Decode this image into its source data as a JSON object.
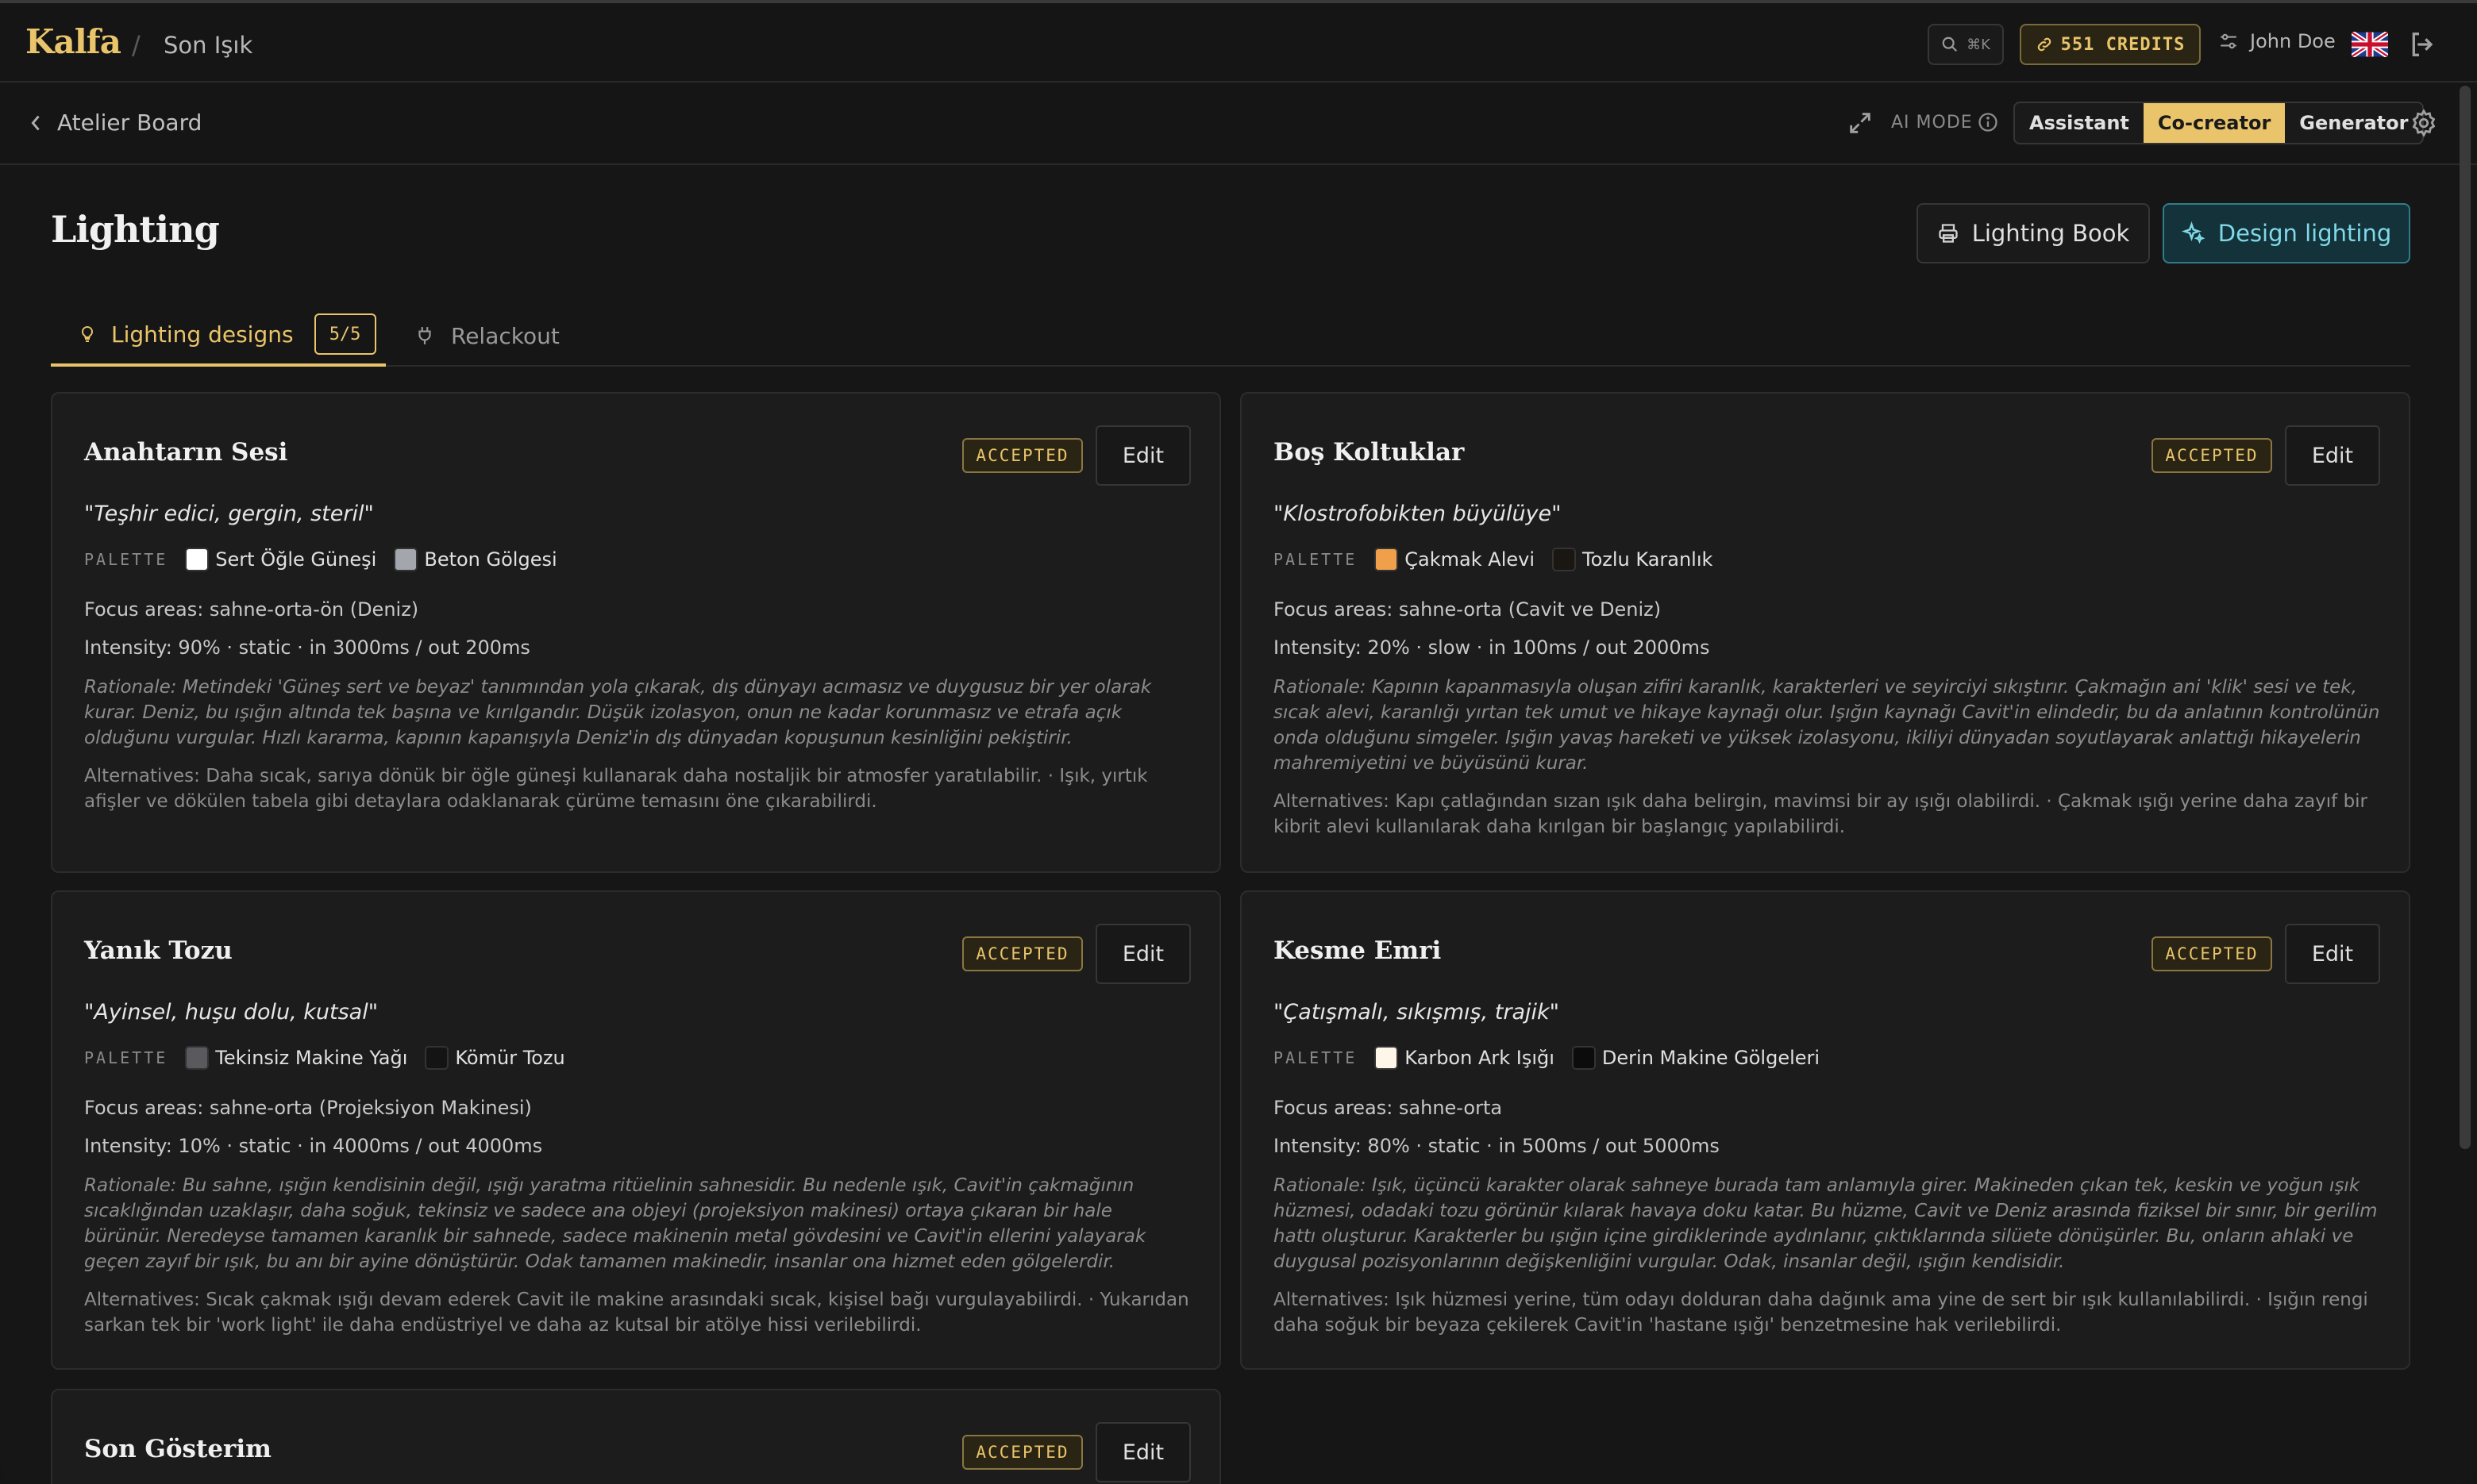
{
  "app": {
    "brand": "Kalfa",
    "separator": "/",
    "project": "Son Işık"
  },
  "topbar": {
    "search_shortcut": "⌘K",
    "credits": "551 CREDITS",
    "user_name": "John Doe"
  },
  "subbar": {
    "back_label": "Atelier Board",
    "ai_mode_label": "AI MODE",
    "modes": [
      "Assistant",
      "Co-creator",
      "Generator"
    ],
    "active_mode": "Co-creator"
  },
  "page": {
    "title": "Lighting",
    "book_button": "Lighting Book",
    "design_button": "Design lighting"
  },
  "tabs": [
    {
      "label": "Lighting designs",
      "count": "5/5",
      "active": true
    },
    {
      "label": "Relackout",
      "active": false
    }
  ],
  "colors": {
    "accent": "#e9c46a",
    "teal": "#7fd9e8",
    "background": "#161616",
    "card": "#1c1c1c"
  },
  "cards": [
    {
      "title": "Anahtarın Sesi",
      "status": "ACCEPTED",
      "edit": "Edit",
      "mood": "\"Teşhir edici, gergin, steril\"",
      "palette_label": "PALETTE",
      "palette": [
        {
          "name": "Sert Öğle Güneşi",
          "color": "#ffffff"
        },
        {
          "name": "Beton Gölgesi",
          "color": "#a3a6ad"
        }
      ],
      "focus": "Focus areas: sahne-orta-ön (Deniz)",
      "intensity": "Intensity: 90% · static · in 3000ms / out 200ms",
      "rationale": "Rationale: Metindeki 'Güneş sert ve beyaz' tanımından yola çıkarak, dış dünyayı acımasız ve duygusuz bir yer olarak kurar. Deniz, bu ışığın altında tek başına ve kırılgandır. Düşük izolasyon, onun ne kadar korunmasız ve etrafa açık olduğunu vurgular. Hızlı kararma, kapının kapanışıyla Deniz'in dış dünyadan kopuşunun kesinliğini pekiştirir.",
      "alternatives": "Alternatives: Daha sıcak, sarıya dönük bir öğle güneşi kullanarak daha nostaljik bir atmosfer yaratılabilir. · Işık, yırtık afişler ve dökülen tabela gibi detaylara odaklanarak çürüme temasını öne çıkarabilirdi."
    },
    {
      "title": "Boş Koltuklar",
      "status": "ACCEPTED",
      "edit": "Edit",
      "mood": "\"Klostrofobikten büyülüye\"",
      "palette_label": "PALETTE",
      "palette": [
        {
          "name": "Çakmak Alevi",
          "color": "#f0a04a"
        },
        {
          "name": "Tozlu Karanlık",
          "color": "#1a1612"
        }
      ],
      "focus": "Focus areas: sahne-orta (Cavit ve Deniz)",
      "intensity": "Intensity: 20% · slow · in 100ms / out 2000ms",
      "rationale": "Rationale: Kapının kapanmasıyla oluşan zifiri karanlık, karakterleri ve seyirciyi sıkıştırır. Çakmağın ani 'klik' sesi ve tek, sıcak alevi, karanlığı yırtan tek umut ve hikaye kaynağı olur. Işığın kaynağı Cavit'in elindedir, bu da anlatının kontrolünün onda olduğunu simgeler. Işığın yavaş hareketi ve yüksek izolasyonu, ikiliyi dünyadan soyutlayarak anlattığı hikayelerin mahremiyetini ve büyüsünü kurar.",
      "alternatives": "Alternatives: Kapı çatlağından sızan ışık daha belirgin, mavimsi bir ay ışığı olabilirdi. · Çakmak ışığı yerine daha zayıf bir kibrit alevi kullanılarak daha kırılgan bir başlangıç yapılabilirdi."
    },
    {
      "title": "Yanık Tozu",
      "status": "ACCEPTED",
      "edit": "Edit",
      "mood": "\"Ayinsel, huşu dolu, kutsal\"",
      "palette_label": "PALETTE",
      "palette": [
        {
          "name": "Tekinsiz Makine Yağı",
          "color": "#5a5a5e"
        },
        {
          "name": "Kömür Tozu",
          "color": "#141414"
        }
      ],
      "focus": "Focus areas: sahne-orta (Projeksiyon Makinesi)",
      "intensity": "Intensity: 10% · static · in 4000ms / out 4000ms",
      "rationale": "Rationale: Bu sahne, ışığın kendisinin değil, ışığı yaratma ritüelinin sahnesidir. Bu nedenle ışık, Cavit'in çakmağının sıcaklığından uzaklaşır, daha soğuk, tekinsiz ve sadece ana objeyi (projeksiyon makinesi) ortaya çıkaran bir hale bürünür. Neredeyse tamamen karanlık bir sahnede, sadece makinenin metal gövdesini ve Cavit'in ellerini yalayarak geçen zayıf bir ışık, bu anı bir ayine dönüştürür. Odak tamamen makinedir, insanlar ona hizmet eden gölgelerdir.",
      "alternatives": "Alternatives: Sıcak çakmak ışığı devam ederek Cavit ile makine arasındaki sıcak, kişisel bağı vurgulayabilirdi. · Yukarıdan sarkan tek bir 'work light' ile daha endüstriyel ve daha az kutsal bir atölye hissi verilebilirdi."
    },
    {
      "title": "Kesme Emri",
      "status": "ACCEPTED",
      "edit": "Edit",
      "mood": "\"Çatışmalı, sıkışmış, trajik\"",
      "palette_label": "PALETTE",
      "palette": [
        {
          "name": "Karbon Ark Işığı",
          "color": "#fff6ea"
        },
        {
          "name": "Derin Makine Gölgeleri",
          "color": "#0c0c0c"
        }
      ],
      "focus": "Focus areas: sahne-orta",
      "intensity": "Intensity: 80% · static · in 500ms / out 5000ms",
      "rationale": "Rationale: Işık, üçüncü karakter olarak sahneye burada tam anlamıyla girer. Makineden çıkan tek, keskin ve yoğun ışık hüzmesi, odadaki tozu görünür kılarak havaya doku katar. Bu hüzme, Cavit ve Deniz arasında fiziksel bir sınır, bir gerilim hattı oluşturur. Karakterler bu ışığın içine girdiklerinde aydınlanır, çıktıklarında silüete dönüşürler. Bu, onların ahlaki ve duygusal pozisyonlarının değişkenliğini vurgular. Odak, insanlar değil, ışığın kendisidir.",
      "alternatives": "Alternatives: Işık hüzmesi yerine, tüm odayı dolduran daha dağınık ama yine de sert bir ışık kullanılabilirdi. · Işığın rengi daha soğuk bir beyaza çekilerek Cavit'in 'hastane ışığı' benzetmesine hak verilebilirdi."
    },
    {
      "title": "Son Gösterim",
      "status": "ACCEPTED",
      "edit": "Edit"
    }
  ]
}
